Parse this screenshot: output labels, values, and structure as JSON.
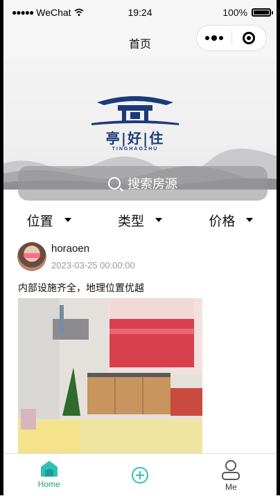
{
  "status_bar": {
    "carrier": "WeChat",
    "time": "19:24",
    "battery": "100%"
  },
  "nav": {
    "title": "首页"
  },
  "banner": {
    "brand": "亭|好|住",
    "brand_pinyin": "TINGHAOZHU"
  },
  "search": {
    "placeholder": "搜索房源"
  },
  "filters": [
    {
      "label": "位置"
    },
    {
      "label": "类型"
    },
    {
      "label": "价格"
    }
  ],
  "post": {
    "username": "horaoen",
    "timestamp": "2023-03-25 00:00:00",
    "description": "内部设施齐全，地理位置优越"
  },
  "tabbar": {
    "home_label": "Home",
    "me_label": "Me"
  },
  "colors": {
    "active_tab": "#1aad5b",
    "home_icon": "#2ec2b4",
    "add_icon": "#2ec2b4",
    "brand_blue": "#1b3a78"
  }
}
